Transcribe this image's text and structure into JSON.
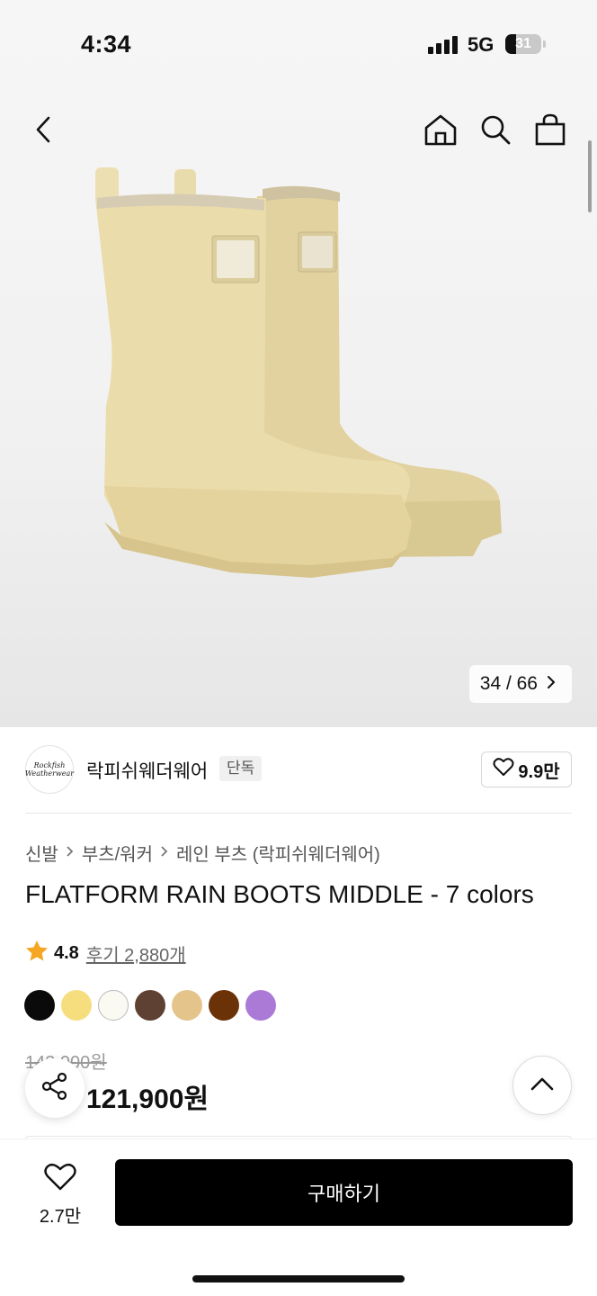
{
  "status_bar": {
    "time": "4:34",
    "network": "5G",
    "battery": "31"
  },
  "nav": {
    "icons": [
      "back-arrow-icon",
      "home-icon",
      "search-icon",
      "shopping-bag-icon"
    ]
  },
  "gallery": {
    "current": "34",
    "total": "66",
    "counter_text": "34 / 66"
  },
  "brand": {
    "name": "락피쉬웨더웨어",
    "badge": "단독",
    "likes": "9.9만",
    "logo_lines": [
      "Rockfish",
      "Weatherwear"
    ]
  },
  "breadcrumb": [
    "신발",
    "부츠/워커",
    "레인 부츠 (락피쉬웨더웨어)"
  ],
  "product": {
    "title": "FLATFORM RAIN BOOTS MIDDLE - 7 colors",
    "rating": "4.8",
    "reviews": "후기 2,880개",
    "original_price": "143,000원",
    "sale_price": "121,900원"
  },
  "colors": [
    "#0a0a0a",
    "#f6de7f",
    "#fbfaf2",
    "#5e4133",
    "#e5c48c",
    "#6b3208",
    "#ab7ad6"
  ],
  "bottom_bar": {
    "wish_count": "2.7만",
    "buy_label": "구매하기"
  }
}
